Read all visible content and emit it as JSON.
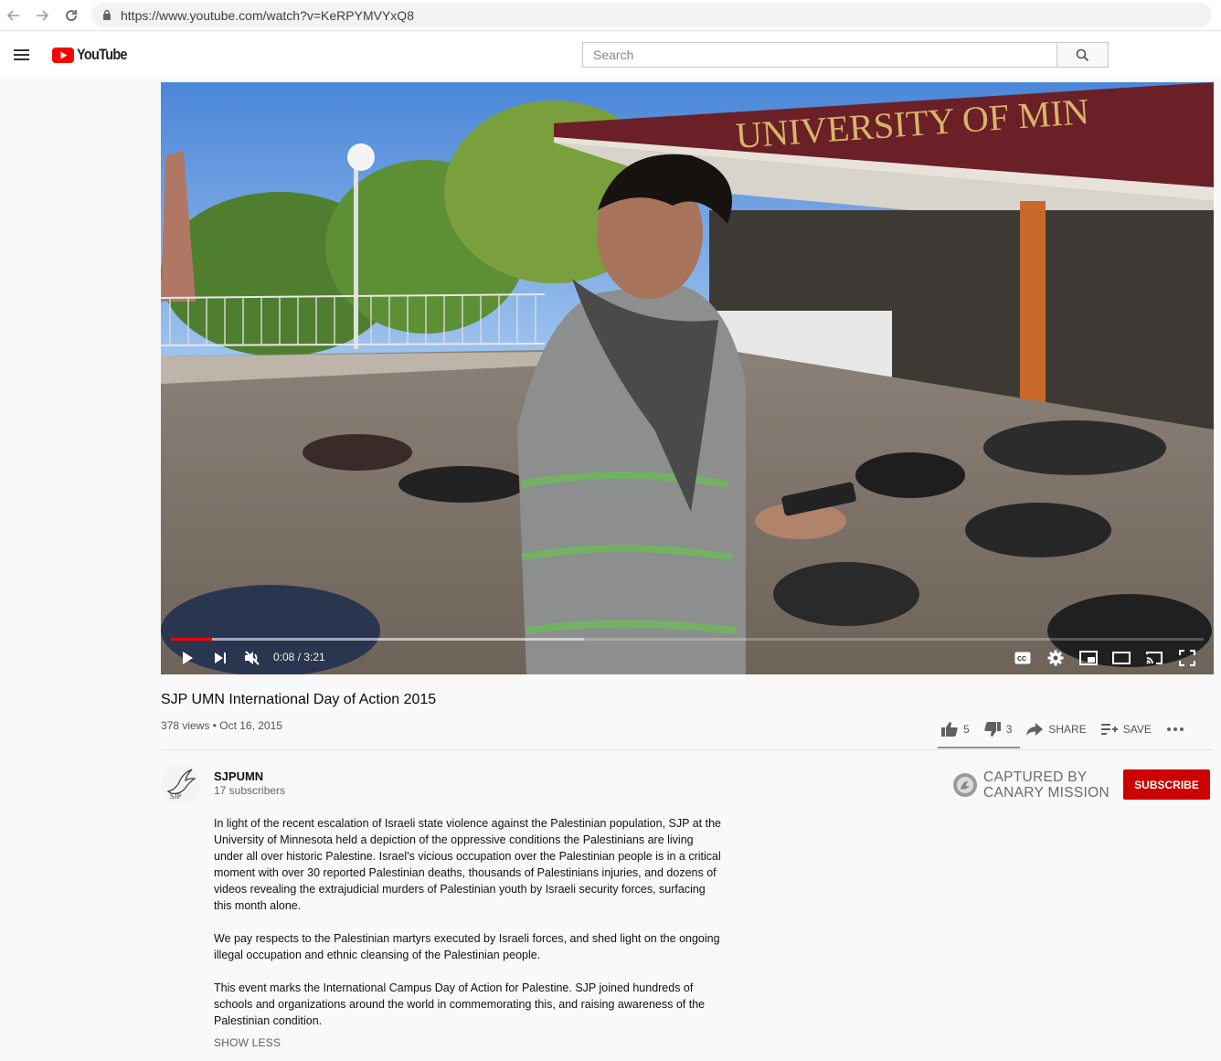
{
  "browser": {
    "url": "https://www.youtube.com/watch?v=KeRPYMVYxQ8"
  },
  "header": {
    "logo_text": "YouTube",
    "search_placeholder": "Search"
  },
  "player": {
    "time": "0:08 / 3:21",
    "progress_fraction": 0.04,
    "buffered_fraction": 0.4,
    "video_signage": "UNIVERSITY OF MIN"
  },
  "video": {
    "title": "SJP UMN International Day of Action 2015",
    "meta": "378 views • Oct 16, 2015",
    "likes": "5",
    "dislikes": "3",
    "share_label": "SHARE",
    "save_label": "SAVE"
  },
  "channel": {
    "name": "SJPUMN",
    "subscribers": "17 subscribers",
    "subscribe_label": "SUBSCRIBE"
  },
  "stamp": {
    "line1": "CAPTURED BY",
    "line2": "CANARY MISSION"
  },
  "description": {
    "paragraphs": [
      "In light of the recent escalation of Israeli state violence against the Palestinian population, SJP at the University of Minnesota held a depiction of the oppressive conditions the Palestinians are living under all over historic Palestine. Israel's vicious occupation over the Palestinian people is in a critical moment with over 30 reported Palestinian deaths, thousands of Palestinians injuries, and dozens of videos revealing the extrajudicial murders of Palestinian youth by Israeli security forces, surfacing this month alone.",
      "We pay respects to the Palestinian martyrs executed by Israeli forces, and shed light on the ongoing illegal occupation and ethnic cleansing of the Palestinian people.",
      "This event marks the International Campus Day of Action for Palestine. SJP joined hundreds of schools and organizations around the world in commemorating this, and raising awareness of the Palestinian condition."
    ],
    "show_less": "SHOW LESS"
  },
  "colors": {
    "brand_red": "#ff0000",
    "subscribe_red": "#cc0000"
  }
}
